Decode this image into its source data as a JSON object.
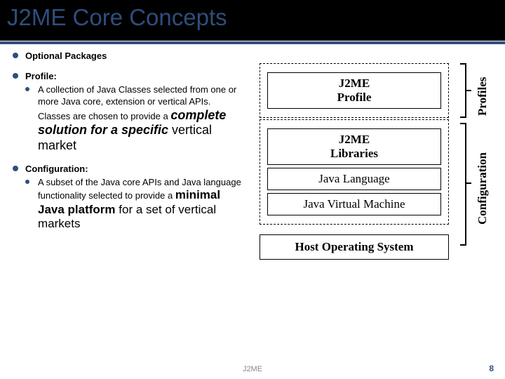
{
  "title": "J2ME Core Concepts",
  "bullets": {
    "b1": "Optional Packages",
    "b2": {
      "head": "Profile:",
      "sub_lead": "A collection of Java Classes selected from one or more Java core, extension or vertical APIs. Classes are chosen to provide a",
      "sub_big_bold": "complete solution for a specific",
      "sub_big_tail": " vertical market"
    },
    "b3": {
      "head": "Configuration:",
      "sub_lead": "A subset of the Java core APIs and Java language functionality selected to provide a ",
      "sub_big_bold": "minimal Java platform",
      "sub_big_tail": " for a set of vertical markets"
    }
  },
  "diagram": {
    "profile": "J2ME\nProfile",
    "libraries": "J2ME\nLibraries",
    "lang": "Java Language",
    "jvm": "Java Virtual Machine",
    "host": "Host Operating System"
  },
  "sideLabels": {
    "profiles": "Profiles",
    "configuration": "Configuration"
  },
  "footer": {
    "center": "J2ME",
    "page": "8"
  }
}
